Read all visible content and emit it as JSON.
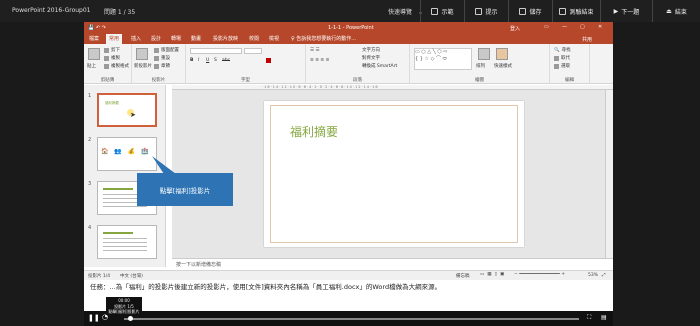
{
  "exam": {
    "title": "PowerPoint 2016-Group01",
    "question": "問題 1 / 35",
    "language": "快速導覽",
    "buttons": [
      "示範",
      "提示",
      "儲存",
      "測驗結束",
      "下一題",
      "結束"
    ]
  },
  "app": {
    "window_title": "1-1-1 - PowerPoint",
    "user": "登入",
    "share": "共用",
    "tabs": [
      "檔案",
      "常用",
      "插入",
      "設計",
      "轉場",
      "動畫",
      "投影片放映",
      "校閱",
      "檢視",
      "♀ 告訴我您想要執行的動作..."
    ],
    "active_tab": "常用",
    "ribbon": {
      "groups": [
        "剪貼簿",
        "投影片",
        "字型",
        "段落",
        "繪圖",
        "編輯"
      ],
      "clipboard": {
        "paste": "貼上",
        "cut": "剪下",
        "copy": "複製",
        "format": "複製格式"
      },
      "slides": {
        "new": "新投影片",
        "layout": "版面配置",
        "reset": "重設",
        "section": "章節"
      },
      "drawing": {
        "arrange": "排列",
        "styles": "快速樣式"
      },
      "editing": {
        "find": "尋找",
        "replace": "取代",
        "select": "選取"
      },
      "paragraph": {
        "text_dir": "文字方向",
        "align": "對齊文字",
        "smartart": "轉換成 SmartArt"
      }
    },
    "thumbnails": [
      {
        "num": "1",
        "title": "福利摘要"
      },
      {
        "num": "2",
        "title": ""
      },
      {
        "num": "3",
        "title": ""
      },
      {
        "num": "4",
        "title": ""
      }
    ],
    "slide_title": "福利摘要",
    "notes_placeholder": "按一下以新增備忘稿",
    "status": {
      "slide": "投影片 1/4",
      "lang": "中文 (台灣)",
      "notes": "備忘稿",
      "zoom": "53%"
    }
  },
  "callout": "點擊[福利]投影片",
  "task": "任務：...為「福利」的投影片後建立新的投影片，使用[文件]資料夾內名稱為「員工福利.docx」的Word檔做為大綱來源。",
  "tooltip": {
    "time": "00:00",
    "slide": "投影片 1/5",
    "label": "點擊[福利]投影片"
  }
}
